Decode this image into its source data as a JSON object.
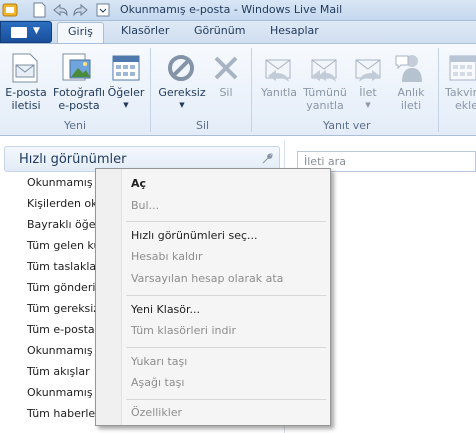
{
  "window": {
    "title": "Okunmamış e-posta - Windows Live Mail"
  },
  "tabs": [
    {
      "label": "Giriş",
      "active": true
    },
    {
      "label": "Klasörler",
      "active": false
    },
    {
      "label": "Görünüm",
      "active": false
    },
    {
      "label": "Hesaplar",
      "active": false
    }
  ],
  "ribbon": {
    "new_group": {
      "label": "Yeni",
      "email_line1": "E-posta",
      "email_line2": "iletisi",
      "photo_line1": "Fotoğraflı",
      "photo_line2": "e-posta",
      "items_label": "Öğeler"
    },
    "delete_group": {
      "label": "Sil",
      "junk_label": "Gereksiz",
      "delete_label": "Sil"
    },
    "reply_group": {
      "label": "Yanıt ver",
      "reply_label": "Yanıtla",
      "reply_all_line1": "Tümünü",
      "reply_all_line2": "yanıtla",
      "forward_label": "İlet",
      "im_line1": "Anlık",
      "im_line2": "ileti"
    },
    "calendar": {
      "line1": "Takvim",
      "line2": "ekle"
    }
  },
  "quick_views": {
    "title": "Hızlı görünümler",
    "items": [
      "Okunmamış",
      "Kişilerden oku",
      "Bayraklı öğele",
      "Tüm gelen ku",
      "Tüm taslaklar",
      "Tüm gönderi",
      "Tüm gereksiz",
      "Tüm e-posta",
      "Okunmamış",
      "Tüm akışlar",
      "Okunmamış",
      "Tüm haberler"
    ]
  },
  "search": {
    "placeholder": "İleti ara"
  },
  "context_menu": {
    "open": "Aç",
    "find": "Bul...",
    "select_quick_views": "Hızlı görünümleri seç...",
    "remove_account": "Hesabı kaldır",
    "set_default": "Varsayılan hesap olarak ata",
    "new_folder": "Yeni Klasör...",
    "download_all": "Tüm klasörleri indir",
    "move_up": "Yukarı taşı",
    "move_down": "Aşağı taşı",
    "properties": "Özellikler"
  },
  "colors": {
    "accent": "#1a4f9a",
    "ribbon_text": "#1e395b"
  }
}
